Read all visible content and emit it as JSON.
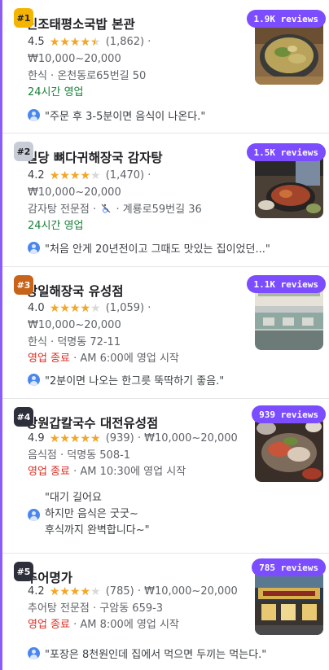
{
  "places": [
    {
      "rank": "#1",
      "rank_bg": "#f4b400",
      "rank_fg": "#202124",
      "name": "신조태평소국밥 본관",
      "rating": "4.5",
      "stars_fraction": 0.9,
      "review_count": "(1,862) ·",
      "price": "₩10,000~20,000",
      "category_line": "한식 · 온천동로65번길 50",
      "status": "24시간 영업",
      "status_type": "open",
      "status_extra": "",
      "review_badge": "1.9K reviews",
      "snippet": "\"주문 후 3-5분이면 음식이 나온다.\""
    },
    {
      "rank": "#2",
      "rank_bg": "#c7ccd6",
      "rank_fg": "#202124",
      "name": "일당 뼈다귀해장국 감자탕",
      "rating": "4.2",
      "stars_fraction": 0.8,
      "review_count": "(1,470) ·",
      "price": "₩10,000~20,000",
      "category_line_a": "감자탕 전문점 ·",
      "category_line_b": "· 계룡로59번길 36",
      "accessibility_icon": "no-wheelchair-icon",
      "status": "24시간 영업",
      "status_type": "open",
      "status_extra": "",
      "review_badge": "1.5K reviews",
      "snippet": "\"처음 안게 20년전이고 그때도 맛있는 집이었던...\""
    },
    {
      "rank": "#3",
      "rank_bg": "#c8641a",
      "rank_fg": "#ffffff",
      "name": "장일해장국 유성점",
      "rating": "4.0",
      "stars_fraction": 0.8,
      "review_count": "(1,059) ·",
      "price": "₩10,000~20,000",
      "category_line": "한식 · 덕명동 72-11",
      "status": "영업 종료",
      "status_type": "closed",
      "status_extra": " · AM 6:00에 영업 시작",
      "review_badge": "1.1K reviews",
      "snippet": "\"2분이면 나오는 한그릇 뚝딱하기 좋음.\""
    },
    {
      "rank": "#4",
      "rank_bg": "#2d2f3a",
      "rank_fg": "#ffffff",
      "name": "상원갑칼국수 대전유성점",
      "rating": "4.9",
      "stars_fraction": 1.0,
      "review_count": "(939) · ₩10,000~20,000",
      "category_line": "음식점 · 덕명동 508-1",
      "status": "영업 종료",
      "status_type": "closed",
      "status_extra": " · AM 10:30에 영업 시작",
      "review_badge": "939 reviews",
      "snippet_lines": [
        "\"대기 길어요",
        "하지만 음식은 굿굿~",
        "후식까지 완벽합니다~\""
      ]
    },
    {
      "rank": "#5",
      "rank_bg": "#2d2f3a",
      "rank_fg": "#ffffff",
      "name": "추어명가",
      "rating": "4.2",
      "stars_fraction": 0.8,
      "review_count": "(785) · ₩10,000~20,000",
      "category_line": "추어탕 전문점 · 구암동 659-3",
      "status": "영업 종료",
      "status_type": "closed",
      "status_extra": " · AM 8:00에 영업 시작",
      "review_badge": "785 reviews",
      "snippet": "\"포장은 8천원인데 집에서 먹으면 두끼는 먹는다.\""
    }
  ]
}
